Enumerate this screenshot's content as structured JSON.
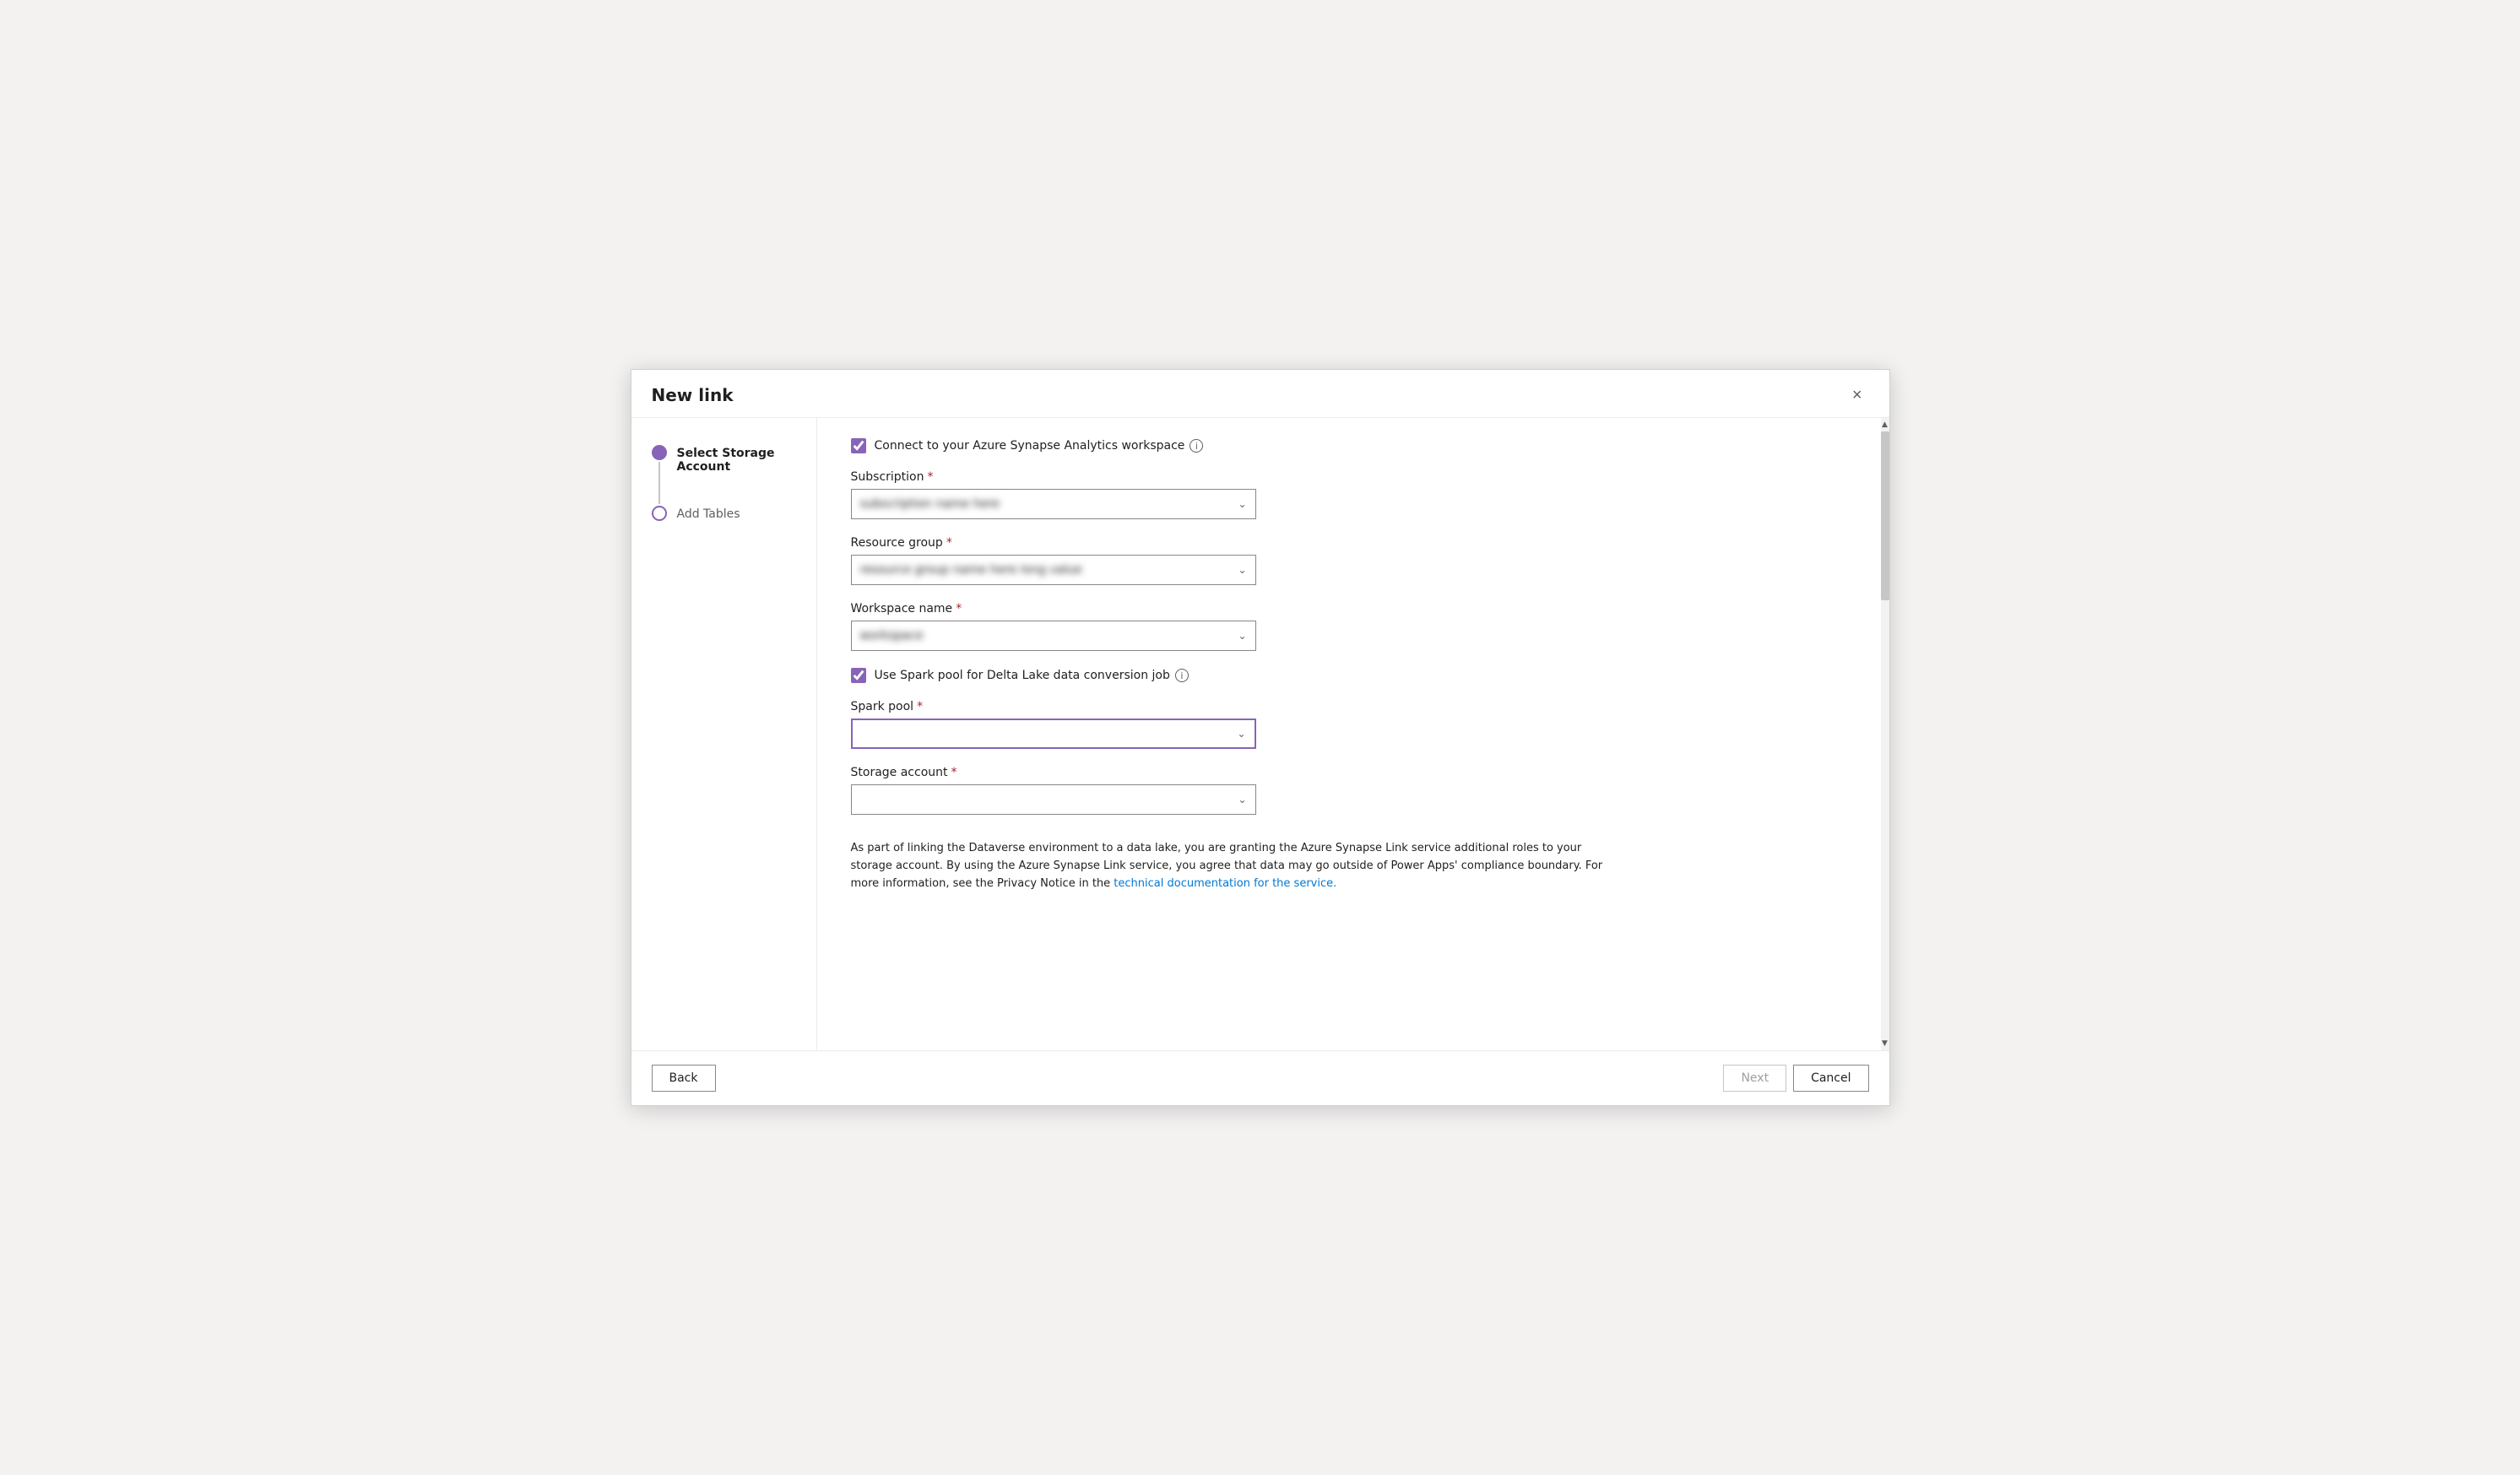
{
  "dialog": {
    "title": "New link",
    "close_label": "×"
  },
  "sidebar": {
    "steps": [
      {
        "id": "select-storage-account",
        "label": "Select Storage Account",
        "active": true
      },
      {
        "id": "add-tables",
        "label": "Add Tables",
        "active": false
      }
    ]
  },
  "form": {
    "synapse_checkbox": {
      "label": "Connect to your Azure Synapse Analytics workspace",
      "checked": true,
      "info": "i"
    },
    "subscription": {
      "label": "Subscription",
      "required": true,
      "value": "blurred_value",
      "placeholder": ""
    },
    "resource_group": {
      "label": "Resource group",
      "required": true,
      "value": "blurred_resource_group_value",
      "placeholder": ""
    },
    "workspace_name": {
      "label": "Workspace name",
      "required": true,
      "value": "blurred_workspace",
      "placeholder": ""
    },
    "spark_pool_checkbox": {
      "label": "Use Spark pool for Delta Lake data conversion job",
      "checked": true,
      "info": "i"
    },
    "spark_pool": {
      "label": "Spark pool",
      "required": true,
      "value": "",
      "placeholder": ""
    },
    "storage_account": {
      "label": "Storage account",
      "required": true,
      "value": "",
      "placeholder": ""
    }
  },
  "notice": {
    "text_before": "As part of linking the Dataverse environment to a data lake, you are granting the Azure Synapse Link service additional roles to your storage account. By using the Azure Synapse Link service, you agree that data may go outside of Power Apps' compliance boundary. For more information, see the Privacy Notice in the",
    "link_text": "technical documentation for the service.",
    "text_after": ""
  },
  "footer": {
    "back_label": "Back",
    "next_label": "Next",
    "cancel_label": "Cancel"
  }
}
